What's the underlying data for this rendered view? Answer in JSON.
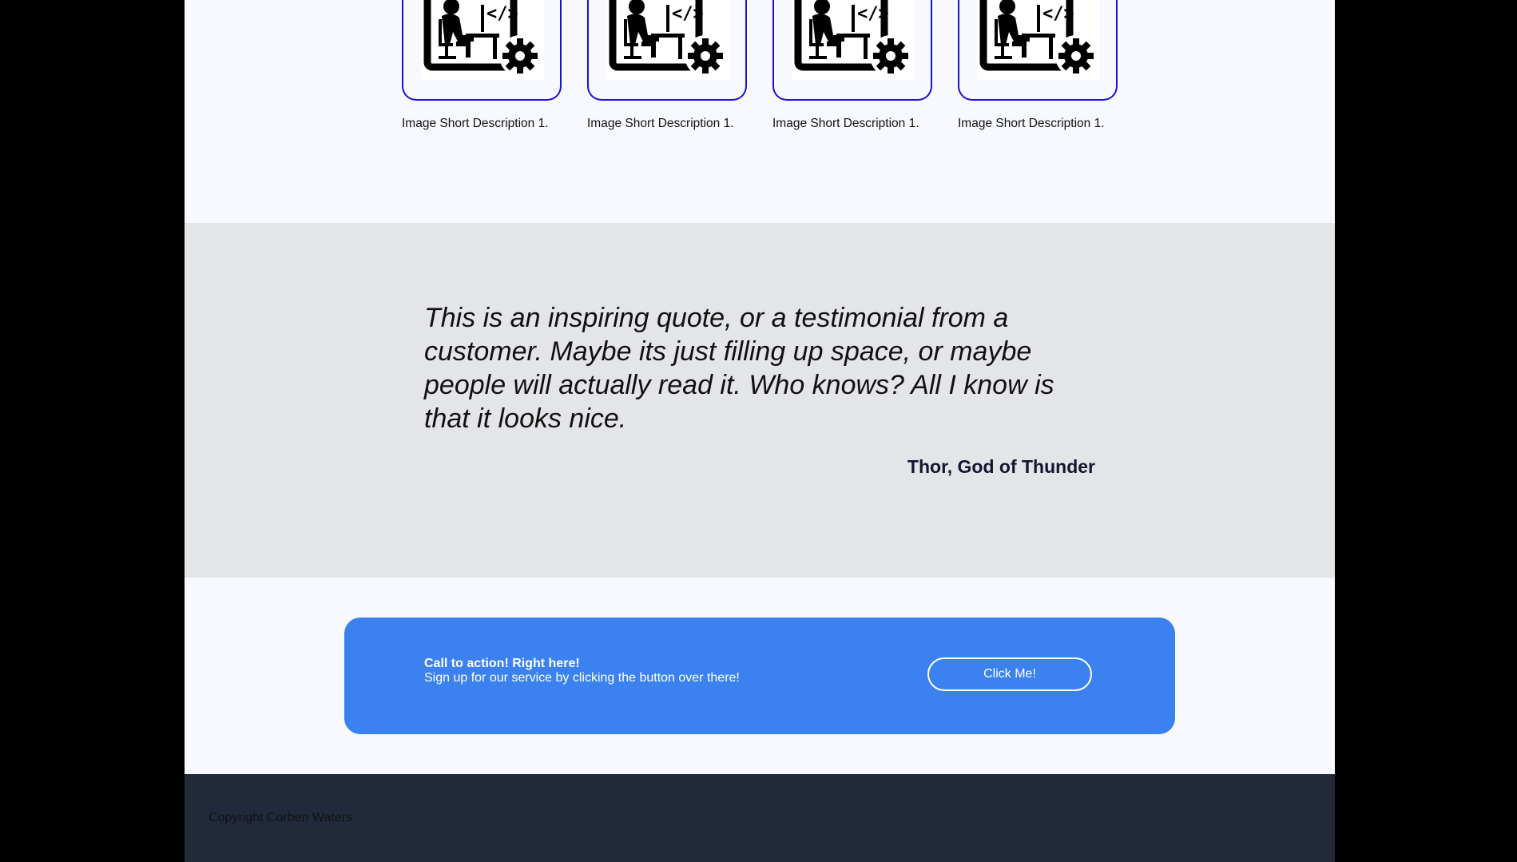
{
  "gallery": {
    "items": [
      {
        "caption": "Image Short Description 1.",
        "icon": "developer-at-desk-icon"
      },
      {
        "caption": "Image Short Description 1.",
        "icon": "developer-at-desk-icon"
      },
      {
        "caption": "Image Short Description 1.",
        "icon": "developer-at-desk-icon"
      },
      {
        "caption": "Image Short Description 1.",
        "icon": "developer-at-desk-icon"
      }
    ],
    "frame_color": "#1a10d6"
  },
  "testimonial": {
    "quote": "This is an inspiring quote, or a testimonial from a customer. Maybe its just filling up space, or maybe people will actually read it. Who knows? All I know is that it looks nice.",
    "author": "Thor, God of Thunder"
  },
  "cta": {
    "title": "Call to action! Right here!",
    "subtitle": "Sign up for our service by clicking the button over there!",
    "button_label": "Click Me!",
    "background_color": "#3b82f0"
  },
  "footer": {
    "copyright": "Copyright Corben Waters",
    "background_color": "#202a3b"
  }
}
